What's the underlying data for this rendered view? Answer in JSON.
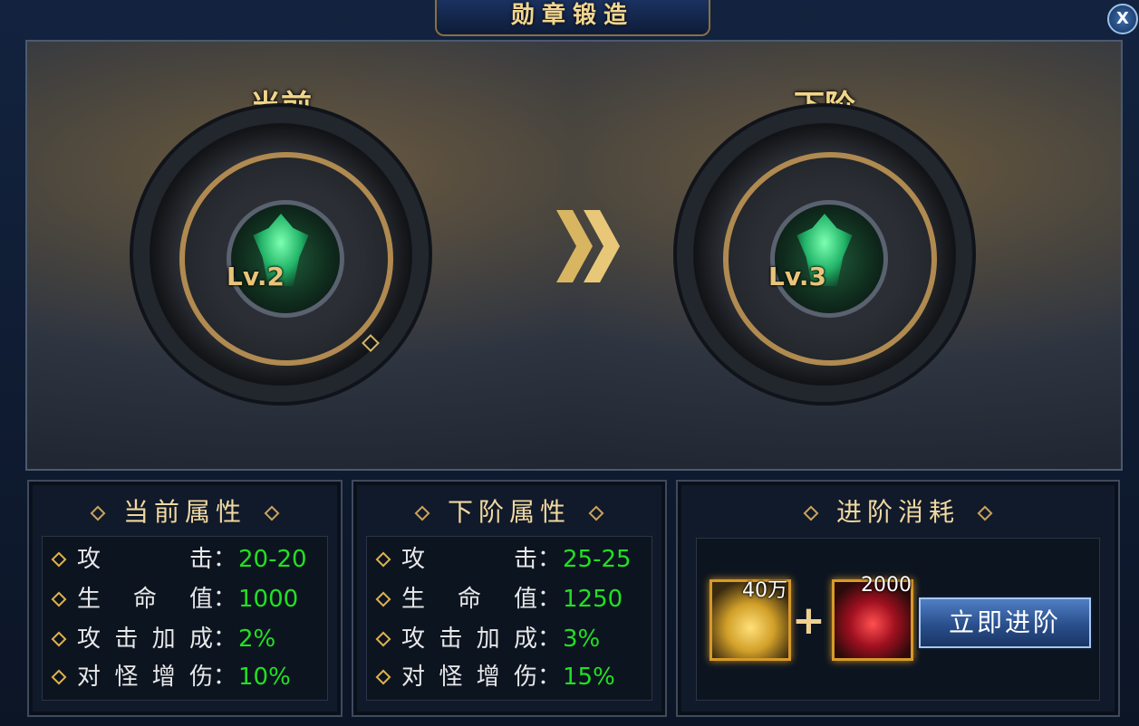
{
  "window": {
    "title": "勋章锻造",
    "close_label": "X"
  },
  "current": {
    "heading": "当前",
    "level": "Lv.2"
  },
  "next": {
    "heading": "下阶",
    "level": "Lv.3"
  },
  "current_attrs": {
    "title": "当前属性",
    "rows": [
      {
        "key": "攻击",
        "value": "20-20"
      },
      {
        "key": "生命值",
        "value": "1000"
      },
      {
        "key": "攻击加成",
        "value": "2%"
      },
      {
        "key": "对怪增伤",
        "value": "10%"
      }
    ]
  },
  "next_attrs": {
    "title": "下阶属性",
    "rows": [
      {
        "key": "攻击",
        "value": "25-25"
      },
      {
        "key": "生命值",
        "value": "1250"
      },
      {
        "key": "攻击加成",
        "value": "3%"
      },
      {
        "key": "对怪增伤",
        "value": "15%"
      }
    ]
  },
  "cost": {
    "title": "进阶消耗",
    "items": [
      {
        "icon": "gold-ingot-icon",
        "quantity": "40万"
      },
      {
        "icon": "red-gem-icon",
        "quantity": "2000"
      }
    ],
    "plus": "+",
    "button_label": "立即进阶"
  },
  "colors": {
    "accent_gold": "#f0d58a",
    "value_green": "#22e022",
    "button_blue": "#2a4f8c"
  }
}
